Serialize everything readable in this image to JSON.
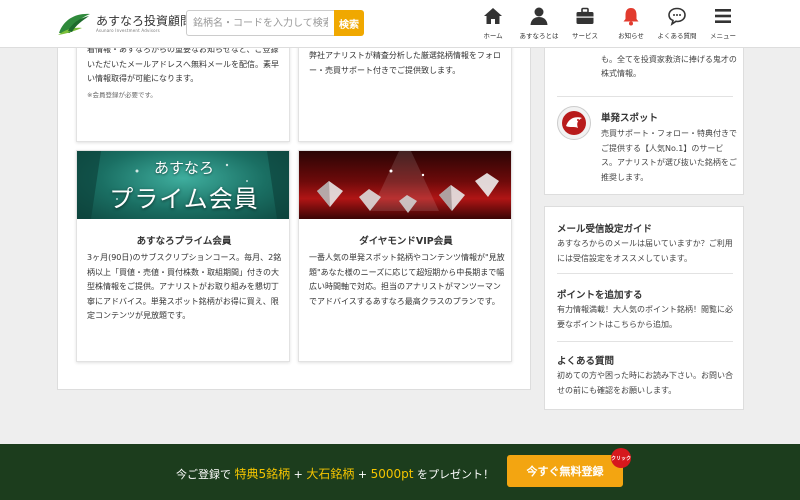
{
  "header": {
    "logo_title": "あすなろ投資顧問",
    "logo_sub": "Asunaro Investment Advisors",
    "search_placeholder": "銘柄名・コードを入力して検索",
    "search_button": "検索",
    "nav": [
      {
        "label": "ホーム",
        "icon": "home-icon"
      },
      {
        "label": "あすなろとは",
        "icon": "person-icon"
      },
      {
        "label": "サービス",
        "icon": "briefcase-icon"
      },
      {
        "label": "お知らせ",
        "icon": "bell-icon"
      },
      {
        "label": "よくある質問",
        "icon": "chat-bubble-icon"
      },
      {
        "label": "メニュー",
        "icon": "hamburger-menu-icon"
      }
    ]
  },
  "cards_top": {
    "left": {
      "text": "着情報・あすなろからの重要なお知らせなど、ご登録いただいたメールアドレスへ無料メールを配信。素早い情報取得が可能になります。",
      "note": "※会員登録が必要です。"
    },
    "right": {
      "text": "弊社アナリストが精査分析した厳選銘柄情報をフォロー・売買サポート付きでご提供致します。"
    }
  },
  "cards_bottom": {
    "left": {
      "banner_line1": "あすなろ",
      "banner_line2": "プライム会員",
      "title": "あすなろプライム会員",
      "text": "3ヶ月(90日)のサブスクリプションコース。毎月、2銘柄以上「買値・売値・買付株数・取組期間」付きの大型株情報をご提供。アナリストがお取り組みを懇切丁寧にアドバイス。単発スポット銘柄がお得に買え、限定コンテンツが見放題です。"
    },
    "right": {
      "title": "ダイヤモンドVIP会員",
      "text": "一番人気の単発スポット銘柄やコンテンツ情報が\"見放題\"あなた様のニーズに応じて超短期から中長期まで幅広い時間軸で対応。担当のアナリストがマンツーマンでアドバイスするあすなろ最高クラスのプランです。"
    }
  },
  "sidebar_top": {
    "item1_text": "基金（IMF）のアナリストとの交友も。全てを投資家救済に捧げる鬼才の株式情報。",
    "item2_title": "単発スポット",
    "item2_text": "売買サポート・フォロー・特典付きでご提供する【人気No.1】のサービス。アナリストが選び抜いた銘柄をご推奨します。"
  },
  "sidebar_links": [
    {
      "title": "メール受信設定ガイド",
      "text": "あすなろからのメールは届いていますか？ご利用には受信設定をオススメしています。"
    },
    {
      "title": "ポイントを追加する",
      "text": "有力情報満載！大人気のポイント銘柄！閲覧に必要なポイントはこちらから追加。"
    },
    {
      "title": "よくある質問",
      "text": "初めての方や困った時にお読み下さい。お問い合せの前にも確認をお願いします。"
    }
  ],
  "footer": {
    "msg_pre": "今ご登録で",
    "hl1": "特典5銘柄",
    "plus1": "+",
    "hl2": "大石銘柄",
    "plus2": "+",
    "hl3": "5000pt",
    "msg_post": "をプレゼント！",
    "button": "今すぐ無料登録",
    "badge": "クリック"
  },
  "colors": {
    "accent": "#f0a800",
    "footer_bg": "#1c3d1d",
    "highlight": "#f4c400",
    "badge": "#d6181d"
  }
}
